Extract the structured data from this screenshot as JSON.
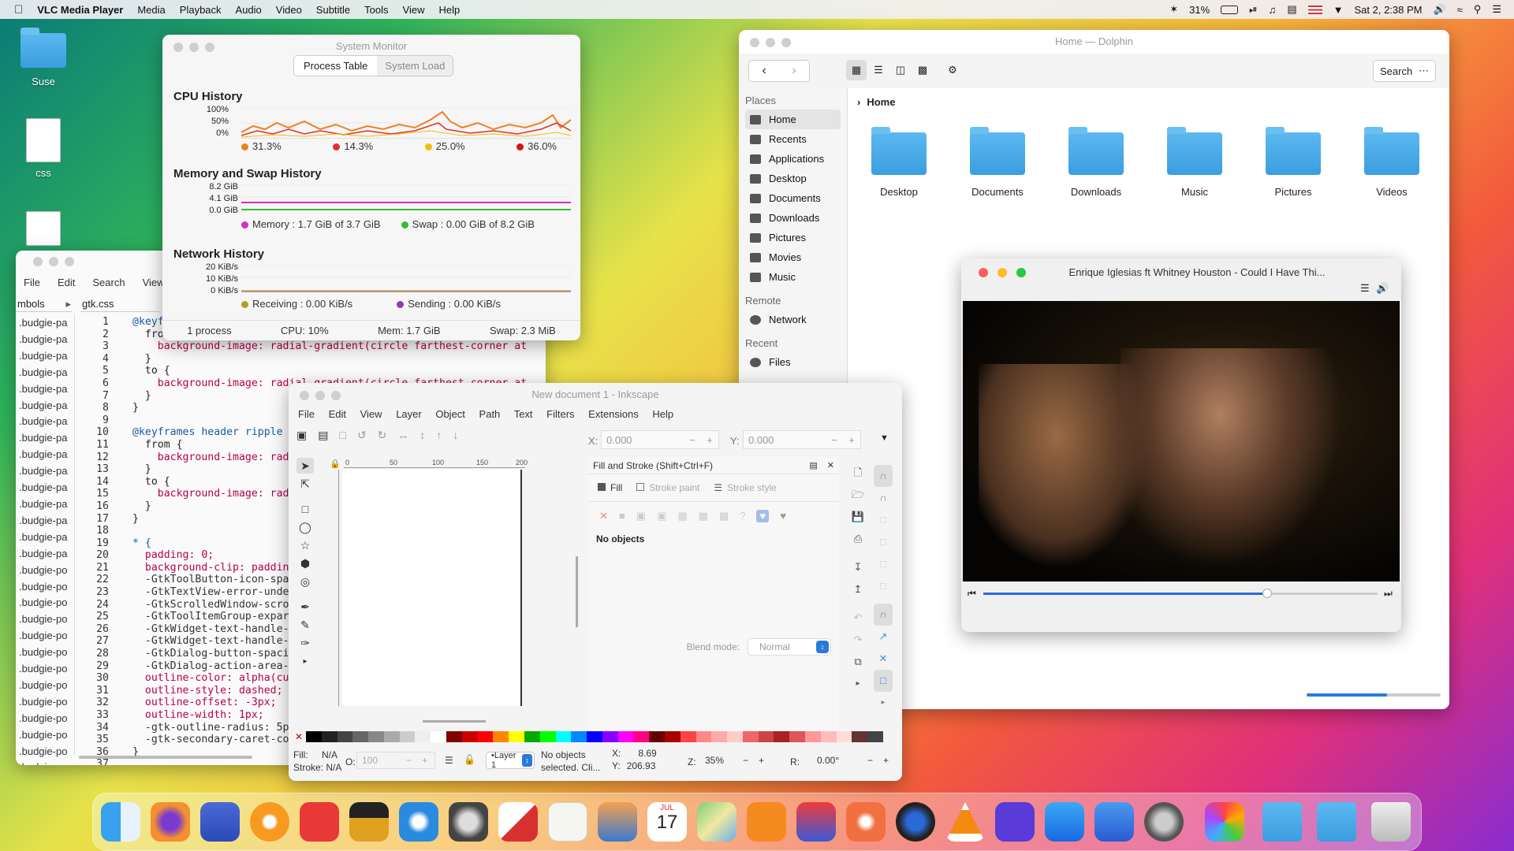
{
  "menubar": {
    "app": "VLC Media Player",
    "items": [
      "Media",
      "Playback",
      "Audio",
      "Video",
      "Subtitle",
      "Tools",
      "View",
      "Help"
    ],
    "battery": "31%",
    "datetime": "Sat 2, 2:38 PM"
  },
  "desktop": {
    "icons": [
      {
        "label": "Suse"
      },
      {
        "label": "css"
      }
    ]
  },
  "sysmon": {
    "title": "System Monitor",
    "tabs": [
      "Process Table",
      "System Load"
    ],
    "cpu": {
      "title": "CPU History",
      "ticks": [
        "100%",
        "50%",
        "0%"
      ],
      "legend": [
        "31.3%",
        "14.3%",
        "25.0%",
        "36.0%"
      ],
      "colors": [
        "#f08020",
        "#e03030",
        "#f0c000",
        "#d01818"
      ]
    },
    "mem": {
      "title": "Memory and Swap History",
      "ticks": [
        "8.2 GiB",
        "4.1 GiB",
        "0.0 GiB"
      ],
      "memory": "Memory : 1.7 GiB of 3.7 GiB",
      "swap": "Swap : 0.00 GiB of 8.2 GiB"
    },
    "net": {
      "title": "Network History",
      "ticks": [
        "20 KiB/s",
        "10 KiB/s",
        "0 KiB/s"
      ],
      "receiving": "Receiving : 0.00 KiB/s",
      "sending": "Sending : 0.00 KiB/s"
    },
    "status": {
      "processes": "1 process",
      "cpu": "CPU: 10%",
      "mem": "Mem: 1.7 GiB",
      "swap": "Swap: 2.3 MiB"
    }
  },
  "editor": {
    "title": "gtk.css",
    "menu": [
      "File",
      "Edit",
      "Search",
      "View"
    ],
    "symbols_label": "mbols",
    "tab": "gtk.css",
    "symbols": [
      ".budgie-pa",
      ".budgie-pa",
      ".budgie-pa",
      ".budgie-pa",
      ".budgie-pa",
      ".budgie-pa",
      ".budgie-pa",
      ".budgie-pa",
      ".budgie-pa",
      ".budgie-pa",
      ".budgie-pa",
      ".budgie-pa",
      ".budgie-pa",
      ".budgie-pa",
      ".budgie-pa",
      ".budgie-po",
      ".budgie-po",
      ".budgie-po",
      ".budgie-po",
      ".budgie-po",
      ".budgie-po",
      ".budgie-po",
      ".budgie-po",
      ".budgie-po",
      ".budgie-po",
      ".budgie-po",
      ".budgie-po",
      ".budgie-po"
    ],
    "lines": [
      "@keyf",
      "  fro",
      "    background-image: radial-gradient(circle farthest-corner at",
      "  }",
      "  to {",
      "    background-image: radial-gradient(circle farthest-corner at",
      "  }",
      "}",
      "",
      "@keyframes header ripple",
      "  from {",
      "    background-image: rad",
      "  }",
      "  to {",
      "    background-image: rad",
      "  }",
      "}",
      "",
      "* {",
      "  padding: 0;",
      "  background-clip: paddin",
      "  -GtkToolButton-icon-spa",
      "  -GtkTextView-error-unde",
      "  -GtkScrolledWindow-scro",
      "  -GtkToolItemGroup-expar",
      "  -GtkWidget-text-handle-",
      "  -GtkWidget-text-handle-",
      "  -GtkDialog-button-spaci",
      "  -GtkDialog-action-area-",
      "  outline-color: alpha(cu",
      "  outline-style: dashed;",
      "  outline-offset: -3px;",
      "  outline-width: 1px;",
      "  -gtk-outline-radius: 5p",
      "  -gtk-secondary-caret-co",
      "}",
      ""
    ]
  },
  "dolphin": {
    "title": "Home — Dolphin",
    "search": "Search",
    "breadcrumb": "Home",
    "places_header": "Places",
    "places": [
      "Home",
      "Recents",
      "Applications",
      "Desktop",
      "Documents",
      "Downloads",
      "Pictures",
      "Movies",
      "Music"
    ],
    "remote_header": "Remote",
    "remote": [
      "Network"
    ],
    "recent_header": "Recent",
    "recent": [
      "Files"
    ],
    "folders": [
      "Desktop",
      "Documents",
      "Downloads",
      "Music",
      "Pictures",
      "Videos"
    ],
    "zoom_level": 0.6
  },
  "vlc": {
    "title": "Enrique Iglesias ft Whitney Houston - Could I Have Thi...",
    "progress": 0.72
  },
  "inkscape": {
    "title": "New document 1 - Inkscape",
    "menu": [
      "File",
      "Edit",
      "View",
      "Layer",
      "Object",
      "Path",
      "Text",
      "Filters",
      "Extensions",
      "Help"
    ],
    "x_label": "X:",
    "x_value": "0.000",
    "y_label": "Y:",
    "y_value": "0.000",
    "ruler": [
      "0",
      "50",
      "100",
      "150",
      "200"
    ],
    "panel_title": "Fill and Stroke (Shift+Ctrl+F)",
    "panel_tabs": [
      "Fill",
      "Stroke paint",
      "Stroke style"
    ],
    "no_objects": "No objects",
    "blend_label": "Blend mode:",
    "blend_value": "Normal",
    "fill_label": "Fill:",
    "fill_value": "N/A",
    "stroke_label": "Stroke:",
    "stroke_value": "N/A",
    "opacity_label": "O:",
    "opacity_value": "100",
    "layer": "•Layer 1",
    "status": "No objects selected. Cli...",
    "cx_label": "X:",
    "cx": "8.69",
    "cy_label": "Y:",
    "cy": "206.93",
    "zoom_label": "Z:",
    "zoom": "35%",
    "rot_label": "R:",
    "rot": "0.00°"
  },
  "dock": {
    "calendar_month": "JUL",
    "calendar_day": "17"
  }
}
